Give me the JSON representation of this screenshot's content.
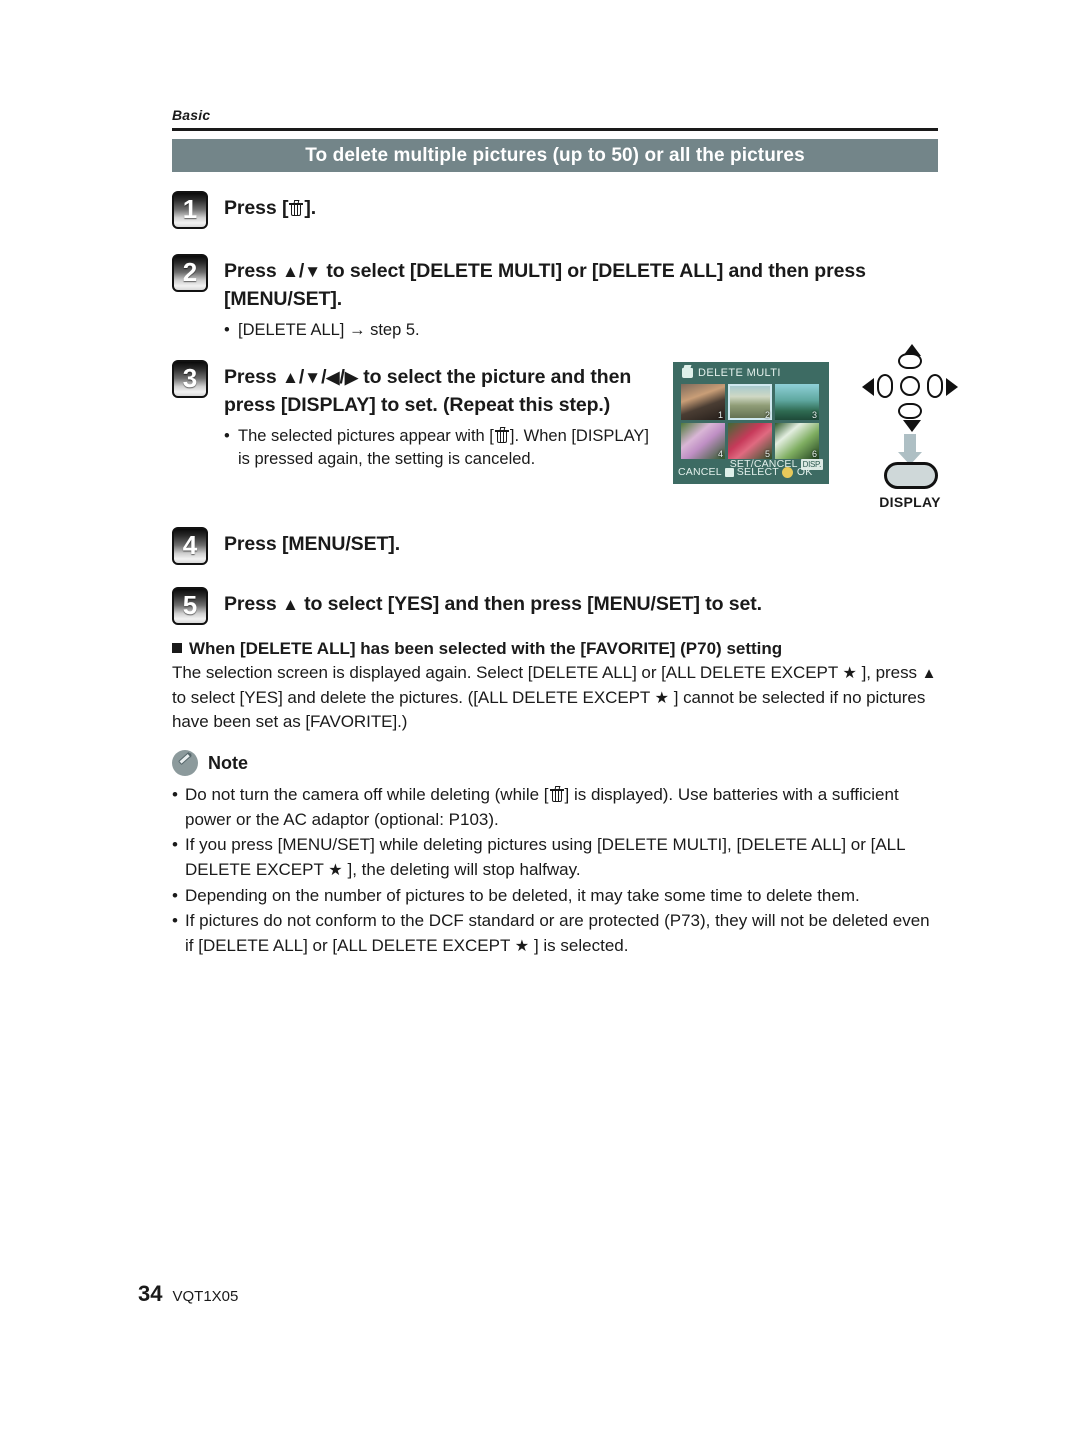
{
  "page": {
    "running_head": "Basic",
    "page_number": "34",
    "doc_code": "VQT1X05"
  },
  "section": {
    "title": "To delete multiple pictures (up to 50) or all the pictures",
    "title_bar_color": "#738589"
  },
  "steps": [
    {
      "number": "1",
      "heading_pre": "Press [",
      "heading_post": "].",
      "icon": "trash-icon"
    },
    {
      "number": "2",
      "heading_a": "Press ",
      "heading_b": "/",
      "heading_c": " to select [DELETE MULTI] or [DELETE ALL] and then press [MENU/SET].",
      "bullet": "[DELETE ALL]  step 5.",
      "bullet_pre": "[DELETE ALL] ",
      "bullet_arrow": "→",
      "bullet_post": " step 5."
    },
    {
      "number": "3",
      "heading_a": "Press ",
      "heading_b": " to select the picture and then press [DISPLAY] to set. (Repeat this step.)",
      "bullet_pre": "The selected pictures appear with [",
      "bullet_post": "]. When [DISPLAY] is pressed again, the setting is canceled."
    },
    {
      "number": "4",
      "heading": "Press [MENU/SET]."
    },
    {
      "number": "5",
      "heading_pre": "Press ",
      "heading_post": " to select [YES] and then press [MENU/SET] to set."
    }
  ],
  "favorite_section": {
    "heading_pre": "When [DELETE ALL] has been selected with the [FAVORITE] (P70) setting",
    "body_1": "The selection screen is displayed again. Select [DELETE ALL] or [ALL DELETE EXCEPT ",
    "body_2": " ], press ",
    "body_3": " to select [YES] and delete the pictures. ([ALL DELETE EXCEPT",
    "body_4": " ] cannot be selected if no pictures have been set as [FAVORITE].)"
  },
  "note": {
    "label": "Note",
    "items": [
      {
        "pre": "Do not turn the camera off while deleting (while [",
        "post": "] is displayed). Use batteries with a sufficient power or the AC adaptor (optional: P103)."
      },
      {
        "pre": "If you press [MENU/SET] while deleting pictures using [DELETE MULTI], [DELETE ALL] or [ALL DELETE EXCEPT ",
        "post": " ], the deleting will stop halfway."
      },
      {
        "pre": "Depending on the number of pictures to be deleted, it may take some time to delete them.",
        "post": ""
      },
      {
        "pre": "If pictures do not conform to the DCF standard or are protected (P73), they will not be deleted even if [DELETE ALL] or [ALL DELETE EXCEPT ",
        "post": " ] is selected."
      }
    ]
  },
  "figure_lcd": {
    "screen_title": "DELETE MULTI",
    "thumbnails": [
      {
        "index": "1",
        "selected": false
      },
      {
        "index": "2",
        "selected": true
      },
      {
        "index": "3",
        "selected": false
      },
      {
        "index": "4",
        "selected": false
      },
      {
        "index": "5",
        "selected": false
      },
      {
        "index": "6",
        "selected": false
      }
    ],
    "set_cancel_label": "SET/CANCEL",
    "set_cancel_chip": "DISP.",
    "bottom_cancel": "CANCEL",
    "bottom_select": "SELECT",
    "bottom_ok": "OK",
    "background_color": "#3d6b63"
  },
  "figure_nav": {
    "display_label": "DISPLAY"
  }
}
